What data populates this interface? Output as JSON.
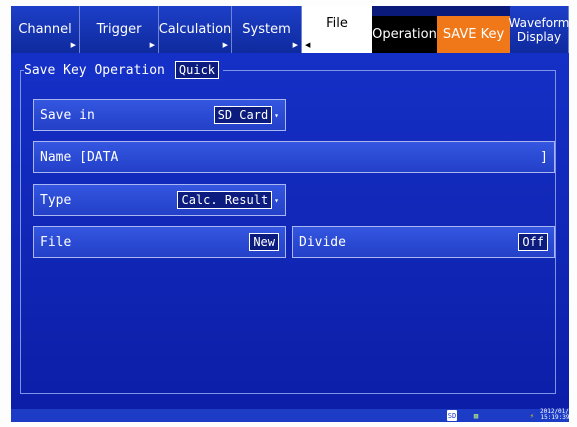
{
  "tabs": [
    {
      "label": "Channel"
    },
    {
      "label": "Trigger"
    },
    {
      "label": "Calculation"
    },
    {
      "label": "System"
    },
    {
      "label": "File"
    },
    {
      "label": "Operation"
    },
    {
      "label": "SAVE Key"
    },
    {
      "label_line1": "Waveform",
      "label_line2": "Display"
    }
  ],
  "group": {
    "title": "Save Key Operation",
    "mode": "Quick"
  },
  "fields": {
    "save_in": {
      "label": "Save in",
      "value": "SD Card"
    },
    "name": {
      "label": "Name [DATA",
      "close": "]"
    },
    "type": {
      "label": "Type",
      "value": "Calc. Result"
    },
    "file": {
      "label": "File",
      "value": "New"
    },
    "divide": {
      "label": "Divide",
      "value": "Off"
    }
  },
  "status": {
    "sd": "SD",
    "date": "2012/01/25",
    "time": "15:19:39"
  },
  "colors": {
    "panel": "#1530c6",
    "tab_blue": "#1d3fc8",
    "save_key_tab": "#f07818",
    "active_tab": "#ffffff"
  },
  "icons": [
    "dropdown-arrow-icon",
    "sd-card-icon",
    "usb-icon",
    "power-icon"
  ]
}
